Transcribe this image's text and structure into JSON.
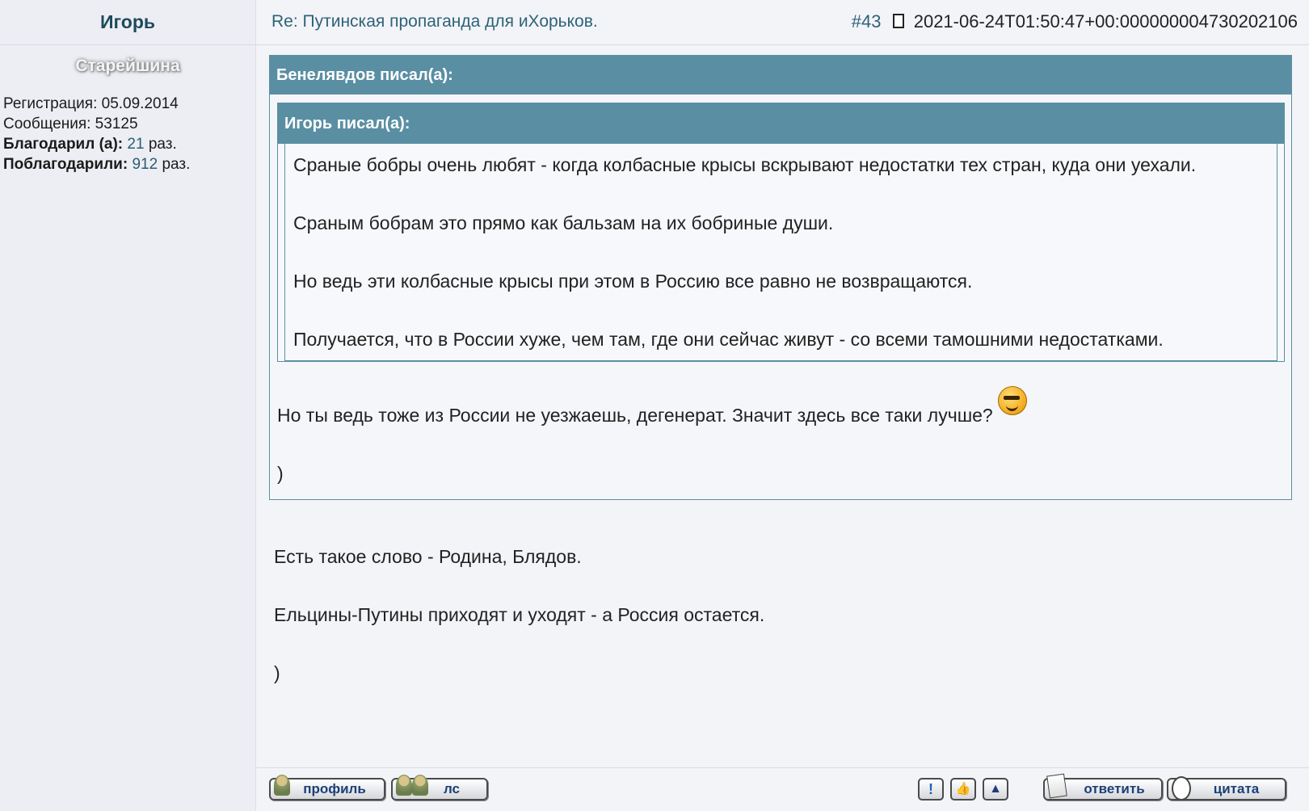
{
  "author": {
    "name": "Игорь",
    "rank": "Старейшина",
    "registration": "Регистрация: 05.09.2014",
    "messages": "Сообщения: 53125",
    "thanked_label": "Благодарил (а):",
    "thanked_count": "21",
    "thanked_suffix": "раз.",
    "was_thanked_label": "Поблагодарили:",
    "was_thanked_count": "912",
    "was_thanked_suffix": "раз."
  },
  "post": {
    "subject": "Re: Путинская пропаганда для иХорьков.",
    "number": "#43",
    "timestamp": "2021-06-24T01:50:47+00:000000004730202106"
  },
  "quote_outer": {
    "title": "Бенелявдов писал(а):",
    "reply_text": "Но ты ведь тоже из России не уезжаешь, дегенерат. Значит здесь все таки лучше?",
    "reply_tail": ")"
  },
  "quote_inner": {
    "title": "Игорь писал(а):",
    "paragraphs": [
      "Сраные бобры очень любят - когда колбасные крысы вскрывают недостатки тех стран, куда они уехали.",
      "Сраным бобрам это прямо как бальзам на их бобриные души.",
      "Но ведь эти колбасные крысы при этом в Россию все равно не возвращаются.",
      "Получается, что в России хуже, чем там, где они сейчас живут - со всеми тамошними недостатками."
    ]
  },
  "body": {
    "paragraphs": [
      "Есть такое слово - Родина, Блядов.",
      "Ельцины-Путины приходят и уходят - а Россия остается.",
      ")"
    ]
  },
  "buttons": {
    "profile": "профиль",
    "pm": "лс",
    "report": "!",
    "thanks": "👍",
    "top": "▲",
    "reply": "ответить",
    "quote": "цитата"
  },
  "icons": {
    "post_link": "document-icon",
    "smiley": "cool-smiley-icon"
  },
  "colors": {
    "quote_header": "#5a8fa3",
    "link": "#2d6378",
    "author_name": "#1e4a5c"
  }
}
